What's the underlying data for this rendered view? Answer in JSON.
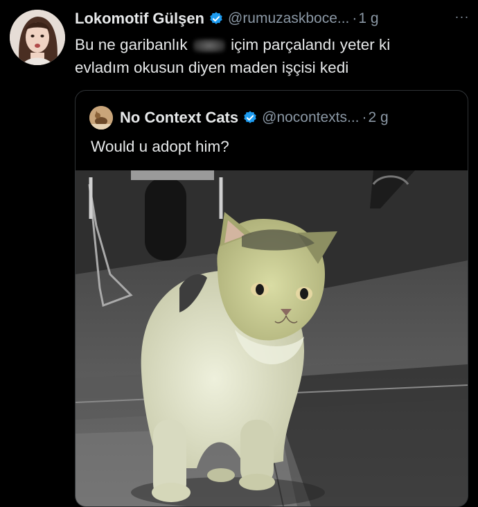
{
  "tweet": {
    "display_name": "Lokomotif Gülşen",
    "handle": "@rumuzaskboce...",
    "separator": "·",
    "time": "1 g",
    "more_label": "···",
    "text_line1_before": "Bu ne garibanlık",
    "text_line1_after": "içim parçalandı yeter ki",
    "text_line2": "evladım okusun diyen maden işçisi kedi"
  },
  "quoted": {
    "display_name": "No Context Cats",
    "handle": "@nocontexts...",
    "separator": "·",
    "time": "2 g",
    "text": "Would u adopt him?"
  },
  "colors": {
    "background": "#000000",
    "text": "#e7e9ea",
    "secondary": "#8b98a5",
    "verified": "#1d9bf0",
    "border": "#2f3336"
  },
  "icons": {
    "verified": "verified-badge-icon",
    "more": "more-dots-icon"
  }
}
